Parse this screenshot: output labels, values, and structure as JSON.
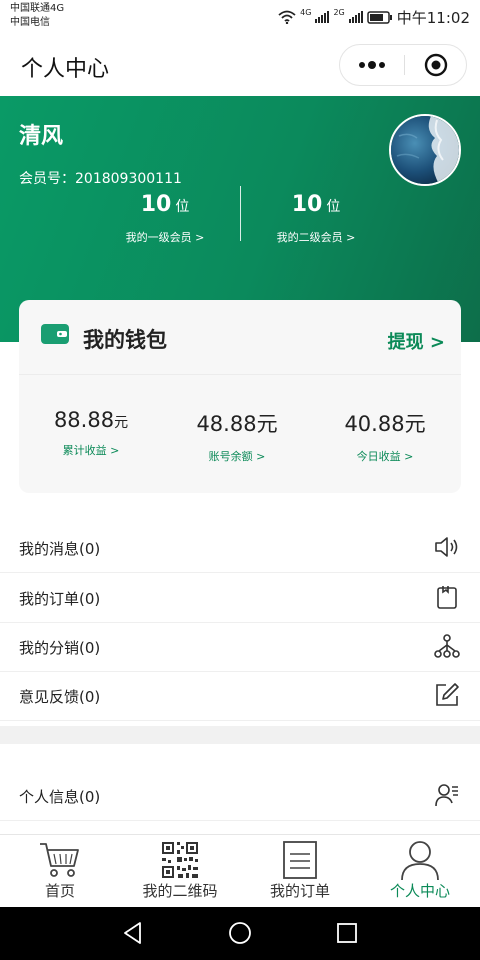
{
  "status_bar": {
    "carrier_1": "中国联通4G",
    "carrier_2": "中国电信",
    "signal_1": "4G",
    "signal_2": "2G",
    "time": "中午11:02"
  },
  "header": {
    "title": "个人中心",
    "more_icon": "ellipsis-icon",
    "close_icon": "target-icon"
  },
  "profile": {
    "name": "清风",
    "member_no": "会员号：201809300111",
    "level1": {
      "count": "10",
      "unit": "位",
      "label": "我的一级会员 >"
    },
    "level2": {
      "count": "10",
      "unit": "位",
      "label": "我的二级会员 >"
    }
  },
  "wallet": {
    "title": "我的钱包",
    "withdraw": "提现 >",
    "items": [
      {
        "amount": "88.88",
        "unit": "元",
        "label": "累计收益 >"
      },
      {
        "amount": "48.88",
        "unit": "元",
        "label": "账号余额 >"
      },
      {
        "amount": "40.88",
        "unit": "元",
        "label": "今日收益 >"
      }
    ]
  },
  "menu": [
    {
      "label": "我的消息(0)",
      "icon": "speaker-icon"
    },
    {
      "label": "我的订单(0)",
      "icon": "clipboard-icon"
    },
    {
      "label": "我的分销(0)",
      "icon": "network-icon"
    },
    {
      "label": "意见反馈(0)",
      "icon": "edit-icon"
    },
    {
      "label": "个人信息(0)",
      "icon": "user-info-icon"
    }
  ],
  "tabs": [
    {
      "label": "首页",
      "icon": "cart-icon"
    },
    {
      "label": "我的二维码",
      "icon": "qrcode-icon"
    },
    {
      "label": "我的订单",
      "icon": "document-icon"
    },
    {
      "label": "个人中心",
      "icon": "person-icon"
    }
  ],
  "colors": {
    "brand_green": "#0c8a58",
    "banner_start": "#0a9a66",
    "banner_end": "#0d6e4a"
  }
}
